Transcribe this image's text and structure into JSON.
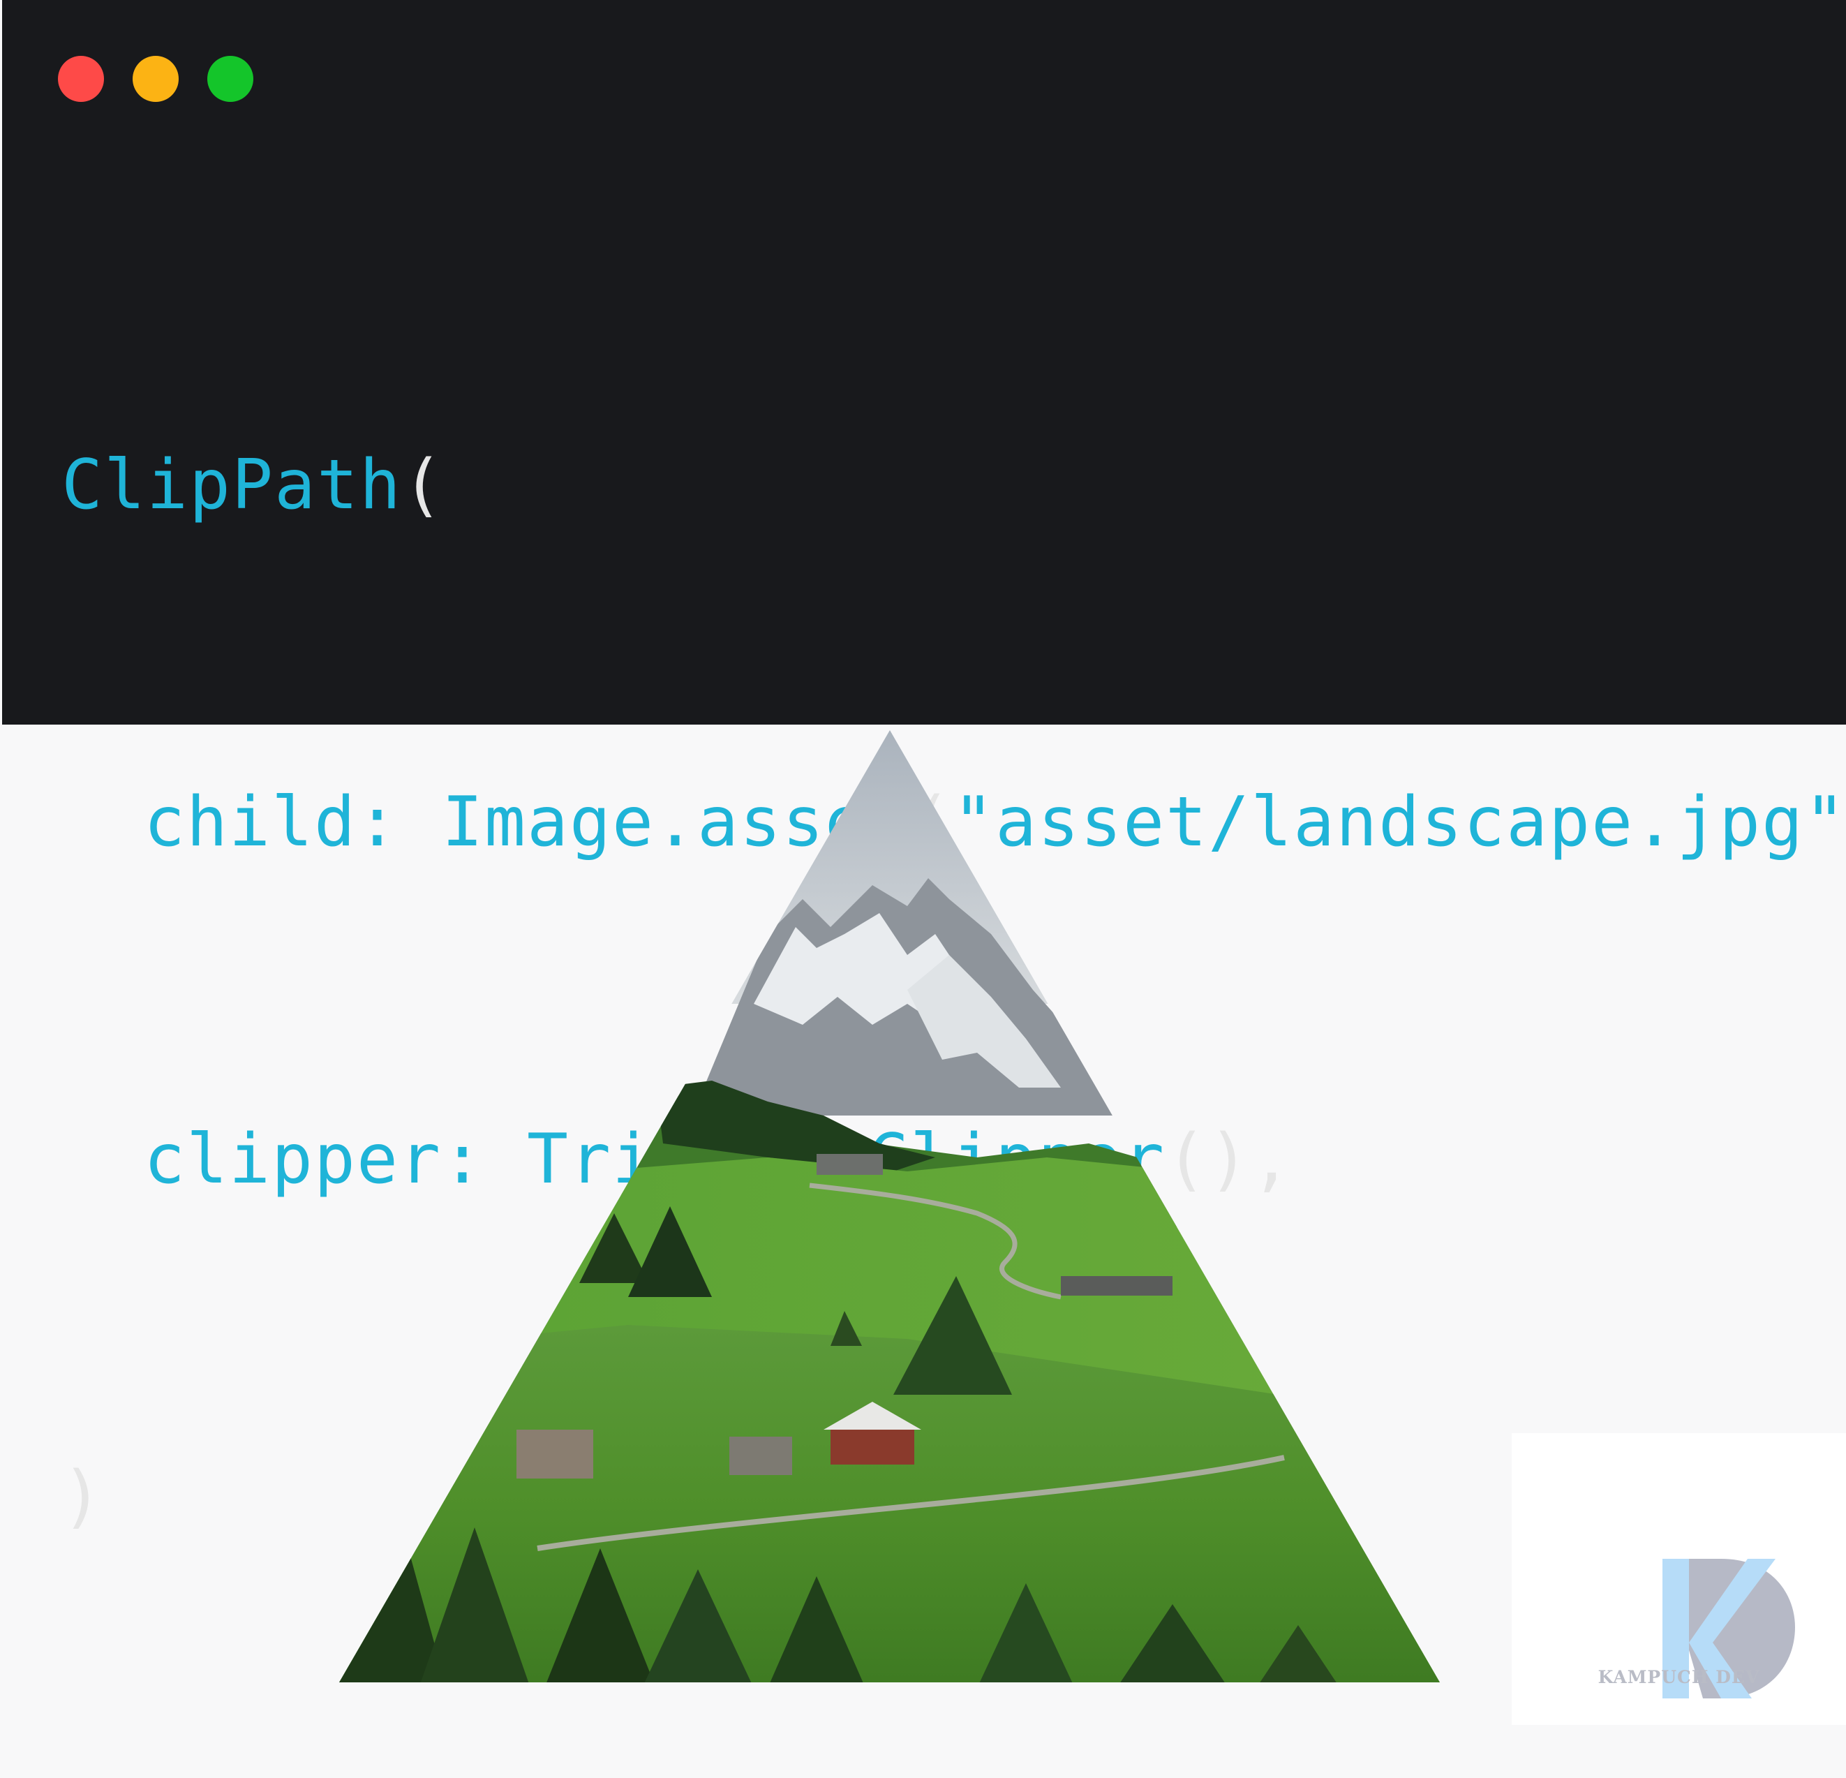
{
  "window": {
    "controls": [
      "close",
      "minimize",
      "zoom"
    ],
    "colors": {
      "close": "#fe4a48",
      "minimize": "#fcb314",
      "zoom": "#14c52a",
      "background": "#18191c"
    }
  },
  "code": {
    "line1": {
      "ident": "ClipPath",
      "open": "("
    },
    "line2": {
      "key": "child:",
      "ident1": "Image.asset",
      "open": "(",
      "string": "\"asset/landscape.jpg\"",
      "close": "),"
    },
    "line3": {
      "key": "clipper:",
      "ident": "TriangleClipper",
      "call": "(),"
    },
    "line4": {
      "close": ")"
    }
  },
  "preview": {
    "image_description_icon": "triangle-clipped-landscape",
    "watermark": {
      "initial": "K",
      "text": "KAMPUCH DEV"
    }
  },
  "colors": {
    "code_accent": "#1fb4d8",
    "punctuation": "#e6e6e6",
    "canvas": "#f8f8f9"
  }
}
